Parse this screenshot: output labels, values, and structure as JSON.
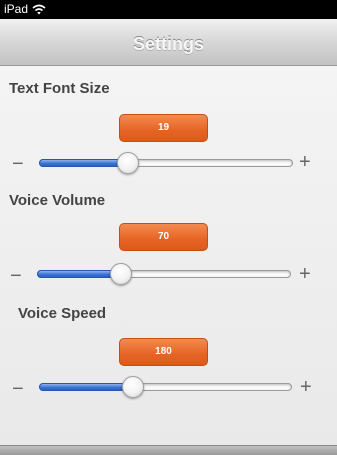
{
  "status_bar": {
    "device": "iPad",
    "icon": "wifi-icon"
  },
  "nav": {
    "title": "Settings"
  },
  "settings": [
    {
      "label": "Text Font Size",
      "value": "19",
      "fraction": 0.35,
      "minus": "−",
      "plus": "+"
    },
    {
      "label": "Voice Volume",
      "value": "70",
      "fraction": 0.33,
      "minus": "−",
      "plus": "+"
    },
    {
      "label": "Voice Speed",
      "value": "180",
      "fraction": 0.37,
      "minus": "−",
      "plus": "+"
    }
  ],
  "colors": {
    "accent_orange": "#e56424",
    "slider_blue": "#3d74d4",
    "nav_title": "#f7f7f7"
  }
}
